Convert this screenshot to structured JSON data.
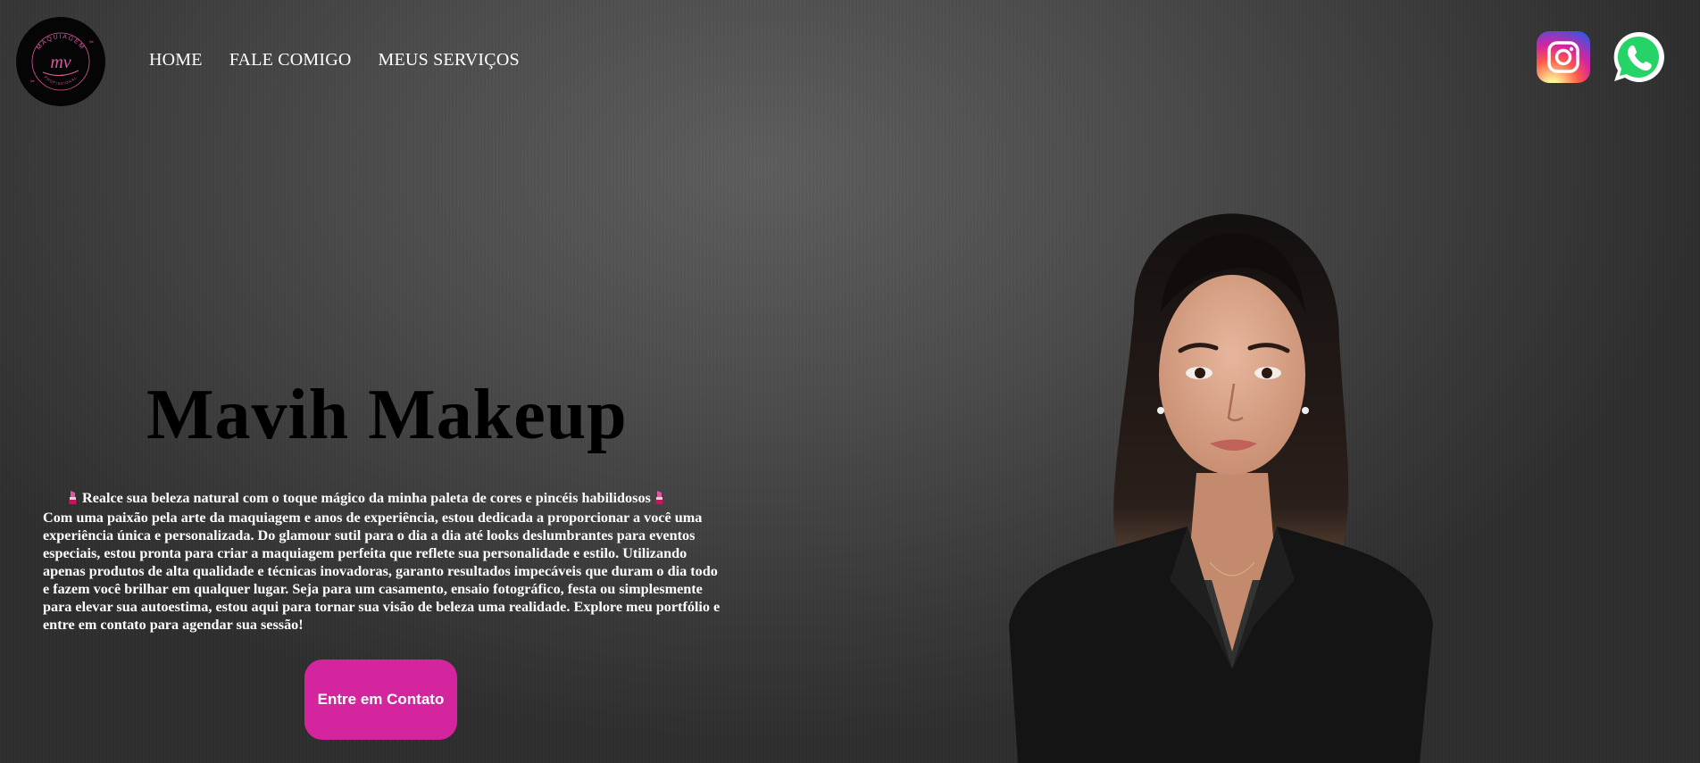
{
  "header": {
    "logo": {
      "arc_text": "MAQUIAGEM",
      "monogram": "mv",
      "bottom_text": "PROFISSIONAL"
    },
    "nav": [
      {
        "label": "HOME"
      },
      {
        "label": "FALE COMIGO"
      },
      {
        "label": "MEUS SERVIÇOS"
      }
    ],
    "social": [
      {
        "icon": "instagram-icon"
      },
      {
        "icon": "whatsapp-icon"
      }
    ]
  },
  "hero": {
    "title": "Mavih Makeup",
    "tagline": "Realce sua beleza natural com o toque mágico da minha paleta de cores e pincéis habilidosos",
    "body": "Com uma paixão pela arte da maquiagem e anos de experiência, estou dedicada a proporcionar a você uma experiência única e personalizada. Do glamour sutil para o dia a dia até looks deslumbrantes para eventos especiais, estou pronta para criar a maquiagem perfeita que reflete sua personalidade e estilo. Utilizando apenas produtos de alta qualidade e técnicas inovadoras, garanto resultados impecáveis que duram o dia todo e fazem você brilhar em qualquer lugar. Seja para um casamento, ensaio fotográfico, festa ou simplesmente para elevar sua autoestima, estou aqui para tornar sua visão de beleza uma realidade. Explore meu portfólio e entre em contato para agendar sua sessão!",
    "cta_label": "Entre em Contato"
  },
  "colors": {
    "accent": "#d4259e",
    "logo_pink": "#e0569f",
    "background": "#4c4c4c"
  }
}
